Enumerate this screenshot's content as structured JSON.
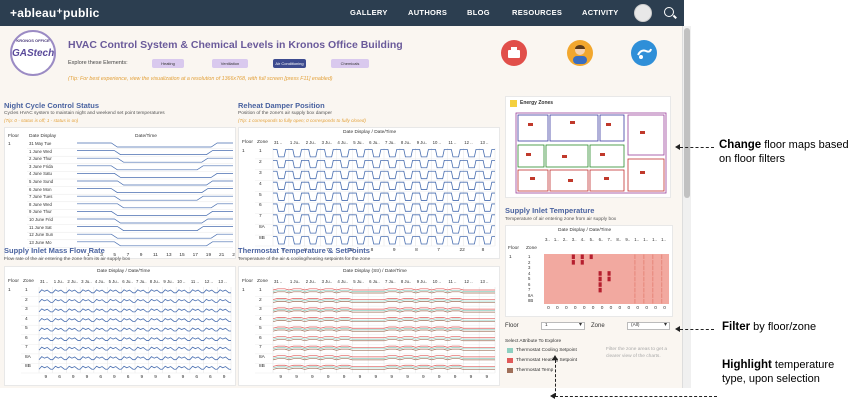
{
  "topbar": {
    "logo": "+ableau⁺public",
    "nav": [
      "GALLERY",
      "AUTHORS",
      "BLOG",
      "RESOURCES",
      "ACTIVITY"
    ]
  },
  "header": {
    "badge_top": "KRONOS OFFICE",
    "badge_main": "GAStech",
    "title": "HVAC Control System & Chemical Levels in Kronos Office Building",
    "explore_label": "Explore these Elements:",
    "pills": [
      "Heating",
      "Ventilation",
      "Air Conditioning",
      "Chemicals"
    ],
    "tip": "(Tip: For best experience, view the visualization at a resolution of 1366x768, with full screen [press F11] enabled)"
  },
  "night_cycle": {
    "title": "Night Cycle Control Status",
    "subtitle": "Cycles HVAC system to maintain night and weekend set point temperatures",
    "tip": "(Tip: 0 - status is off; 1 - status is on)",
    "col_floor": "Floor",
    "col_date": "Date Display",
    "axis_title": "Date/Time",
    "floor": "1",
    "rows": [
      "31 May Tue",
      "1 June Wed",
      "2 June Thur",
      "3 June Frida",
      "4 June Satu",
      "5 June Sund",
      "6 June Mon",
      "7 June Tues",
      "8 June Wed",
      "9 June Thur",
      "10 June Frid",
      "11 June Sat",
      "12 June Sun",
      "13 June Mo"
    ],
    "xticks": [
      "1",
      "3",
      "5",
      "7",
      "9",
      "11",
      "13",
      "15",
      "17",
      "19",
      "21",
      "23"
    ]
  },
  "reheat": {
    "title": "Reheat Damper Position",
    "subtitle": "Position of the zone's air supply box damper",
    "tip": "(Tip: 1 corresponds to fully open; 0 corresponds to fully closed)",
    "col_floor": "Floor",
    "col_zone": "Zone",
    "axis_title": "Date Display  /  Date/Time",
    "dates": [
      "31 ..",
      "1 Ju..",
      "2 Ju..",
      "3 Ju..",
      "4 Ju..",
      "5 Ju..",
      "6 Ju..",
      "7 Ju..",
      "8 Ju..",
      "9 Ju..",
      "10 ..",
      "11 ..",
      "12 ..",
      "13 .."
    ],
    "floor": "1",
    "zones": [
      "1",
      "2",
      "3",
      "4",
      "5",
      "6",
      "7",
      "8A",
      "8B"
    ],
    "xticks": [
      "9",
      "8",
      "7",
      "22",
      "8",
      "9",
      "8",
      "7",
      "22",
      "8"
    ]
  },
  "floor_map": {
    "title": "Energy Zones"
  },
  "supply_temp": {
    "title": "Supply Inlet Temperature",
    "subtitle": "Temperature of air entering zone from air supply box",
    "axis_title": "Date Display  /  Date/Time",
    "col_floor": "Floor",
    "col_zone": "Zone",
    "dates": [
      "3..",
      "1..",
      "2..",
      "3..",
      "4..",
      "5..",
      "6..",
      "7..",
      "8..",
      "9..",
      "1..",
      "1..",
      "1..",
      "1.."
    ],
    "floor": "1",
    "zones": [
      "1",
      "2",
      "3",
      "4",
      "5",
      "6",
      "7",
      "8A",
      "8B"
    ],
    "xticks": [
      "0",
      "0",
      "0",
      "0",
      "0",
      "0",
      "0",
      "0",
      "0",
      "0",
      "0",
      "0",
      "0",
      "0"
    ]
  },
  "filters": {
    "floor_label": "Floor",
    "floor_value": "1",
    "zone_label": "Zone",
    "zone_value": "(All)",
    "attr_label": "Select Attribute To Explore",
    "attrs": [
      {
        "label": "Thermostat Cooling Setpoint",
        "color": "#8ecfc0"
      },
      {
        "label": "Thermostat Heating Setpoint",
        "color": "#e05a5a"
      },
      {
        "label": "Thermostat Temp",
        "color": "#a0705a"
      }
    ],
    "hint": "Filter the zone areas to get a clearer view of the charts."
  },
  "mass_flow": {
    "title": "Supply Inlet Mass Flow Rate",
    "subtitle": "Flow rate of the air entering the zone from its air supply box",
    "axis_title": "Date Display  /  Date/Time",
    "col_floor": "Floor",
    "col_zone": "Zone",
    "dates": [
      "31 ..",
      "1 Ju..",
      "2 Ju..",
      "3 Ju..",
      "4 Ju..",
      "5 Ju..",
      "6 Ju..",
      "7 Ju..",
      "8 Ju..",
      "9 Ju..",
      "10 ..",
      "11 ..",
      "12 ..",
      "13 .."
    ],
    "floor": "1",
    "zones": [
      "1",
      "2",
      "3",
      "4",
      "5",
      "6",
      "7",
      "8A",
      "8B"
    ],
    "xticks": [
      "9",
      "6",
      "9",
      "9",
      "6",
      "9",
      "6",
      "9",
      "9",
      "6",
      "9",
      "6",
      "6",
      "9"
    ]
  },
  "thermostat": {
    "title": "Thermostat Temperature & SetPoints",
    "subtitle": "Temperature of the air & cooling/heating setpoints for the zone",
    "axis_title": "Date Display (Str)  /  Date/Time",
    "col_floor": "Floor",
    "col_zone": "Zone",
    "dates": [
      "31 ..",
      "1 Ju..",
      "2 Ju..",
      "3 Ju..",
      "4 Ju..",
      "5 Ju..",
      "6 Ju..",
      "7 Ju..",
      "8 Ju..",
      "9 Ju..",
      "10 ..",
      "11 ..",
      "12 ..",
      "13 .."
    ],
    "floor": "1",
    "zones": [
      "1",
      "2",
      "3",
      "4",
      "5",
      "6",
      "7",
      "8A",
      "8B"
    ],
    "xticks": [
      "9",
      "9",
      "9",
      "9",
      "9",
      "9",
      "9",
      "9",
      "9",
      "9",
      "9",
      "9",
      "9",
      "9"
    ]
  },
  "annotations": {
    "a1_bold": "Change",
    "a1_rest": " floor maps based on floor filters",
    "a2_bold": "Filter",
    "a2_rest": " by floor/zone",
    "a3_bold": "Highlight",
    "a3_rest": " temperature type, upon selection"
  },
  "colors": {
    "topbar": "#2c3e50",
    "accent": "#4a63a0",
    "line": "#4a6fb0",
    "heat": "#f2a9a0",
    "heat_dark": "#b51f2f",
    "tip": "#e3a13a"
  }
}
